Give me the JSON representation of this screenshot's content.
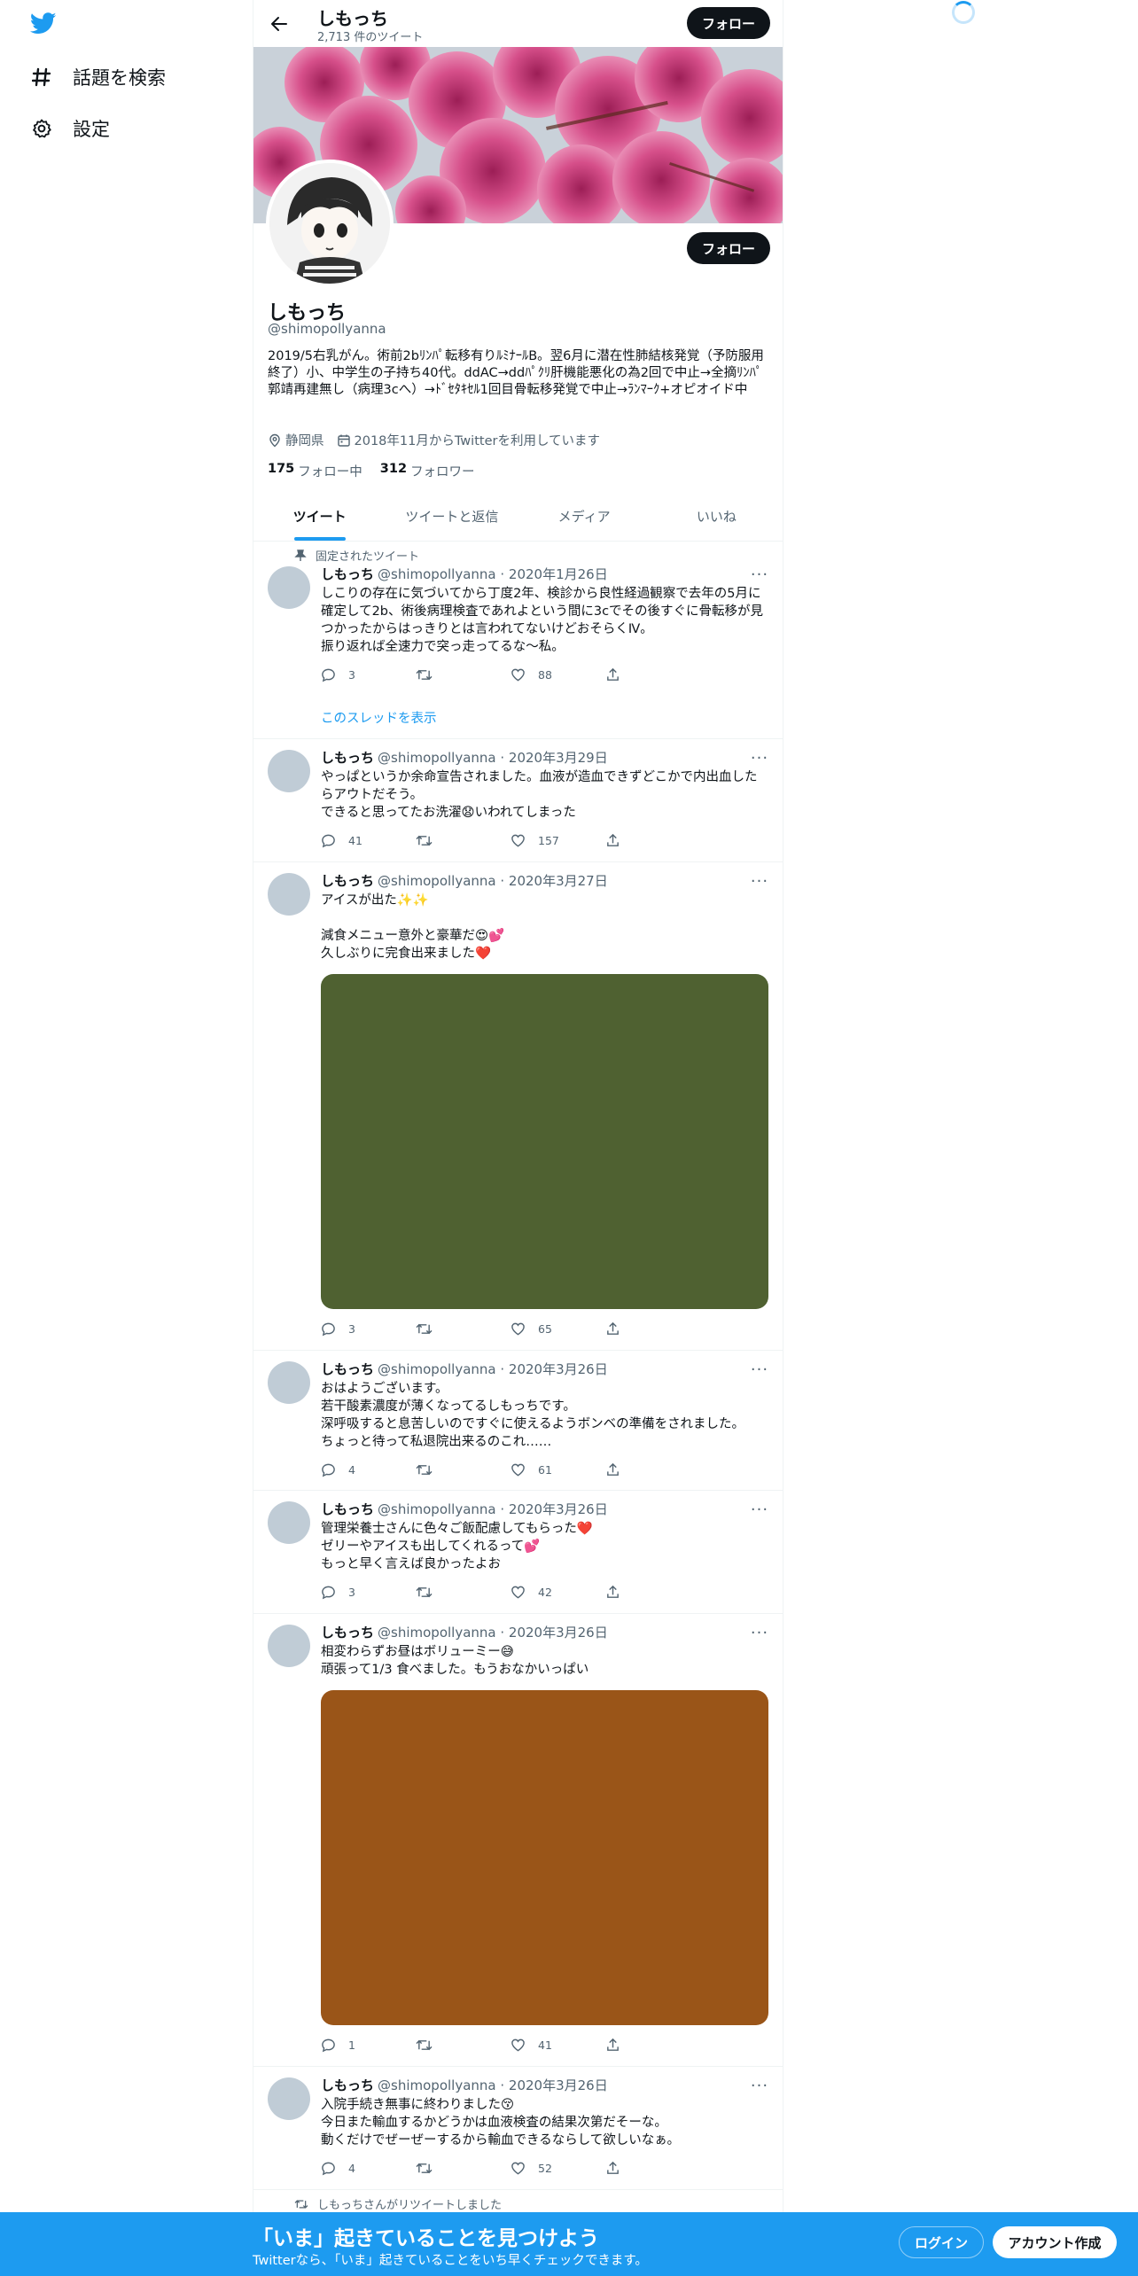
{
  "nav": {
    "items": [
      {
        "label": "話題を検索",
        "icon": "hashtag-icon"
      },
      {
        "label": "設定",
        "icon": "gear-icon"
      }
    ]
  },
  "header": {
    "title": "しもっち",
    "subtitle": "2,713 件のツイート",
    "follow_label": "フォロー"
  },
  "profile": {
    "name": "しもっち",
    "handle": "@shimopollyanna",
    "bio": "2019/5右乳がん。術前2bﾘﾝﾊﾟ転移有りﾙﾐﾅｰﾙB。翌6月に潜在性肺結核発覚（予防服用終了）小、中学生の子持ち40代。ddAC→ddﾊﾟｸﾘ肝機能悪化の為2回で中止→全摘ﾘﾝﾊﾟ郭靖再建無し（病理3cへ）→ﾄﾞｾﾀｷｾﾙ1回目骨転移発覚で中止→ﾗﾝﾏｰｸ+オピオイド中",
    "location": "静岡県",
    "joined": "2018年11月からTwitterを利用しています",
    "following_count": "175",
    "following_label": "フォロー中",
    "followers_count": "312",
    "followers_label": "フォロワー",
    "follow_label": "フォロー"
  },
  "tabs": [
    "ツイート",
    "ツイートと返信",
    "メディア",
    "いいね"
  ],
  "tweets": [
    {
      "context": "固定されたツイート",
      "name": "しもっち",
      "handle": "@shimopollyanna · 2020年1月26日",
      "text": "しこりの存在に気づいてから丁度2年、検診から良性経過観察で去年の5月に確定して2b、術後病理検査であれよという間に3cでその後すぐに骨転移が見つかったからはっきりとは言われてないけどおそらくⅣ。\n振り返れば全速力で突っ走ってるな〜私。",
      "replies": "3",
      "retweets": "",
      "likes": "88",
      "thread_link": "このスレッドを表示"
    },
    {
      "name": "しもっち",
      "handle": "@shimopollyanna · 2020年3月29日",
      "text": "やっぱというか余命宣告されました。血液が造血できずどこかで内出血したらアウトだそう。\nできると思ってたお洗濯😧いわれてしまった",
      "replies": "41",
      "retweets": "",
      "likes": "157"
    },
    {
      "name": "しもっち",
      "handle": "@shimopollyanna · 2020年3月27日",
      "text": "アイスが出た✨✨\n\n減食メニュー意外と豪華だ😍💕\n久しぶりに完食出来ました❤️",
      "media_color": "#4f6131",
      "replies": "3",
      "retweets": "",
      "likes": "65"
    },
    {
      "name": "しもっち",
      "handle": "@shimopollyanna · 2020年3月26日",
      "text": "おはようございます。\n若干酸素濃度が薄くなってるしもっちです。\n深呼吸すると息苦しいのですぐに使えるようボンベの準備をされました。\nちょっと待って私退院出来るのこれ……",
      "replies": "4",
      "retweets": "",
      "likes": "61"
    },
    {
      "name": "しもっち",
      "handle": "@shimopollyanna · 2020年3月26日",
      "text": "管理栄養士さんに色々ご飯配慮してもらった❤️\nゼリーやアイスも出してくれるって💕\nもっと早く言えば良かったよお",
      "replies": "3",
      "retweets": "",
      "likes": "42"
    },
    {
      "name": "しもっち",
      "handle": "@shimopollyanna · 2020年3月26日",
      "text": "相変わらずお昼はボリューミー😅\n頑張って1/3 食べました。もうおなかいっぱい",
      "media_color": "#9a5518",
      "replies": "1",
      "retweets": "",
      "likes": "41"
    },
    {
      "name": "しもっち",
      "handle": "@shimopollyanna · 2020年3月26日",
      "text": "入院手続き無事に終わりました😚\n今日また輸血するかどうかは血液検査の結果次第だそーな。\n動くだけでぜーぜーするから輸血できるならして欲しいなぁ。",
      "replies": "4",
      "retweets": "",
      "likes": "52"
    },
    {
      "context": "しもっちさんがリツイートしました"
    }
  ],
  "bottom_bar": {
    "title": "「いま」起きていることを見つけよう",
    "subtitle": "Twitterなら、「いま」起きていることをいち早くチェックできます。",
    "login_label": "ログイン",
    "signup_label": "アカウント作成"
  },
  "colors": {
    "accent": "#1d9bf0",
    "text": "#0f1419",
    "secondary": "#536471"
  }
}
